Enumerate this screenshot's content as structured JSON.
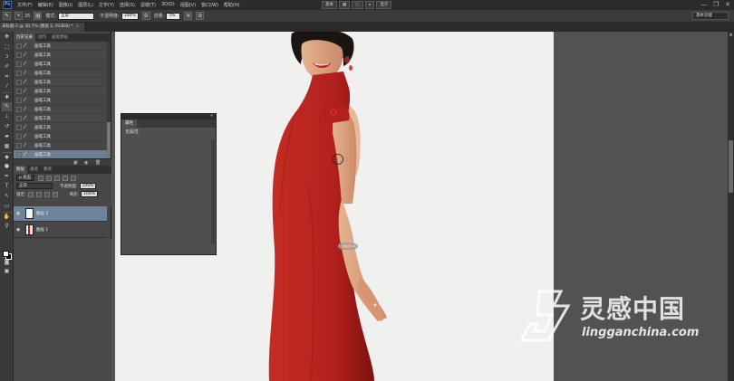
{
  "app": {
    "logo": "Ps",
    "menus": [
      "文件(F)",
      "编辑(E)",
      "图像(I)",
      "图层(L)",
      "文字(Y)",
      "选择(S)",
      "滤镜(T)",
      "3D(D)",
      "视图(V)",
      "窗口(W)",
      "帮助(H)"
    ],
    "center_controls": [
      "基本",
      "▦",
      "▢",
      "⌂",
      "显示"
    ],
    "window_controls": [
      "—",
      "❐",
      "✕"
    ]
  },
  "options": {
    "brush_size": "35",
    "mode_label": "模式:",
    "mode_value": "正常",
    "opacity_label": "不透明度:",
    "opacity_value": "100%",
    "flow_label": "流量:",
    "flow_value": "5%",
    "workspace": "基本功能"
  },
  "document": {
    "tab_title": "未标题-2 @ 30.7% (图层 2, RGB/8) *",
    "close": "×"
  },
  "history": {
    "tabs": [
      "历史记录",
      "动作",
      "画笔预设"
    ],
    "items": [
      "画笔工具",
      "画笔工具",
      "画笔工具",
      "画笔工具",
      "画笔工具",
      "画笔工具",
      "画笔工具",
      "画笔工具",
      "画笔工具",
      "画笔工具",
      "画笔工具",
      "画笔工具",
      "画笔工具"
    ],
    "active_index": 12
  },
  "layers": {
    "tabs": [
      "图层",
      "通道",
      "路径"
    ],
    "kind_label": "ρ 类型",
    "blend_mode": "正常",
    "opacity_label": "不透明度:",
    "opacity_value": "100%",
    "lock_label": "锁定:",
    "fill_label": "填充:",
    "fill_value": "100%",
    "items": [
      {
        "name": "图层 2",
        "active": true
      },
      {
        "name": "图层 1",
        "active": false
      }
    ]
  },
  "properties": {
    "tab": "属性",
    "text": "无属性"
  },
  "watermark": {
    "text": "灵感中国",
    "url": "lingganchina.com"
  },
  "colors": {
    "accent": "#6c839a",
    "dress": "#b3211d",
    "canvas_bg": "#f0f0ee"
  }
}
